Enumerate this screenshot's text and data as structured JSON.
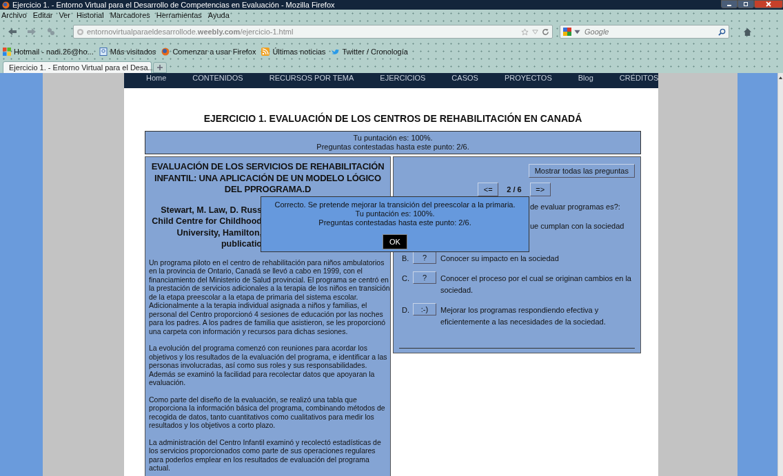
{
  "window": {
    "title": "Ejercicio 1. - Entorno Virtual para el Desarrollo de Competencias en Evaluación - Mozilla Firefox"
  },
  "menu_bar": [
    "Archivo",
    "Editar",
    "Ver",
    "Historial",
    "Marcadores",
    "Herramientas",
    "Ayuda"
  ],
  "navigation": {
    "url": "entornovirtualparaeldesarrollode.**weebly.com**/ejercicio-1.html",
    "search_placeholder": "Google"
  },
  "bookmarks": [
    {
      "label": "Hotmail - nadi.26@ho...",
      "kind": "windows"
    },
    {
      "label": "Más visitados",
      "kind": "page"
    },
    {
      "label": "Comenzar a usar Firefox",
      "kind": "globe"
    },
    {
      "label": "Últimas noticias",
      "kind": "rss"
    },
    {
      "label": "Twitter / Cronología",
      "kind": "bird"
    }
  ],
  "tabs": [
    {
      "label": "Ejercicio 1. - Entorno Virtual para el Desa...",
      "selected": true
    }
  ],
  "site_nav": [
    "Home",
    "CONTENIDOS",
    "RECURSOS POR TEMA",
    "EJERCICIOS",
    "CASOS",
    "PROYECTOS",
    "Blog",
    "CRÉDITOS"
  ],
  "page": {
    "title": "EJERCICIO 1. EVALUACIÓN DE LOS CENTROS DE REHABILITACIÓN EN CANADÁ",
    "score": [
      "Tu puntación es: 100%.",
      "Preguntas contestadas hasta este punto: 2/6."
    ],
    "article": {
      "heading": "EVALUACIÓN DE LOS SERVICIOS DE REHABILITACIÓN INFANTIL: UNA APLICACIÓN DE UN MODELO LÓGICO DEL PPROGRAMA.D",
      "authors": [
        "Stewart, M. Law, D. Russ",
        "Child Centre for Childhood",
        "University, Hamilton,",
        "publicatio"
      ],
      "paragraphs": [
        "Un programa piloto en el centro de rehabilitación para niños ambulatorios en la provincia de Ontario, Canadá se llevó a cabo en 1999, con el financiamiento del Ministerio de Salud provincial. El programa se centró en la prestación de servicios adicionales a la terapia de los niños en transición de la etapa preescolar a la etapa de primaria del sistema escolar. Adicionalmente a la terapia individual asignada a niños y familias, el personal del Centro proporcionó 4 sesiones de educación por las noches para los padres. A los padres de familia que asistieron, se les proporcionó una carpeta con información y recursos para dichas sesiones.",
        "La evolución del programa comenzó con reuniones para acordar los objetivos y los resultados de la evaluación del programa, e identificar a las personas involucradas, así como sus roles y sus responsabilidades. Además se examinó la facilidad para recolectar datos que apoyaran la evaluación.",
        "Como parte del diseño de la evaluación, se realizó una tabla que proporciona la información básica del programa, combinando métodos de recogida de datos, tanto cuantitativos como cualitativos para medir los resultados y los objetivos a corto plazo.",
        "La administración del Centro Infantil examinó y recolectó estadísticas de los servicios proporcionados como parte de sus operaciones regulares para poderlos emplear en los resultados de evaluación del programa actual."
      ]
    },
    "quiz": {
      "show_all": "Mostrar todas las preguntas",
      "prev": "<=",
      "counter": "2 / 6",
      "next": "=>",
      "fragments": [
        "de evaluar programas es?:",
        "ue cumplan con la sociedad"
      ],
      "options": [
        {
          "letter": "B.",
          "button": "?",
          "text": "Conocer su impacto en la sociedad"
        },
        {
          "letter": "C.",
          "button": "?",
          "text": "Conocer el proceso por el cual se originan cambios en la sociedad."
        },
        {
          "letter": "D.",
          "button": ":-)",
          "text": "Mejorar los programas respondiendo efectiva y eficientemente a las necesidades de la sociedad."
        }
      ]
    },
    "dialog": {
      "lines": [
        "Correcto. Se pretende mejorar la transición del preescolar a la primaria.",
        "Tu puntación es: 100%.",
        "Preguntas contestadas hasta este punto: 2/6."
      ],
      "ok": "OK"
    }
  }
}
